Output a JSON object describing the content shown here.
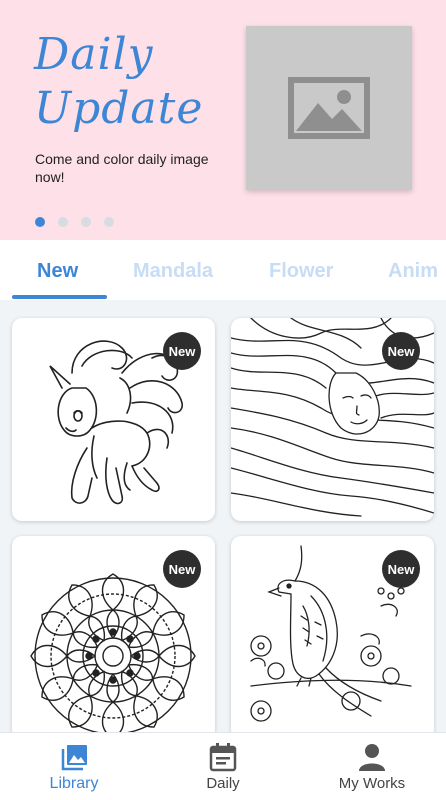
{
  "banner": {
    "title_line1": "Daily",
    "title_line2": "Update",
    "subtitle": "Come and color daily image now!",
    "image_icon": "image-placeholder-icon",
    "pagination_active": 1,
    "pagination_count": 4
  },
  "tabs": [
    {
      "label": "New",
      "active": true
    },
    {
      "label": "Mandala",
      "active": false
    },
    {
      "label": "Flower",
      "active": false
    },
    {
      "label": "Anim",
      "active": false
    }
  ],
  "cards": [
    {
      "subject": "unicorn",
      "badge": "New"
    },
    {
      "subject": "woman-with-flowing-hair",
      "badge": "New"
    },
    {
      "subject": "mandala",
      "badge": "New"
    },
    {
      "subject": "bird-with-flowers",
      "badge": "New"
    }
  ],
  "bottom_nav": [
    {
      "label": "Library",
      "icon": "library-icon",
      "active": true
    },
    {
      "label": "Daily",
      "icon": "calendar-icon",
      "active": false
    },
    {
      "label": "My Works",
      "icon": "person-icon",
      "active": false
    }
  ],
  "colors": {
    "accent": "#3d86d6",
    "banner_bg": "#fde0e8",
    "tab_inactive": "#c7dcf5",
    "badge_bg": "#2e2e2e"
  }
}
